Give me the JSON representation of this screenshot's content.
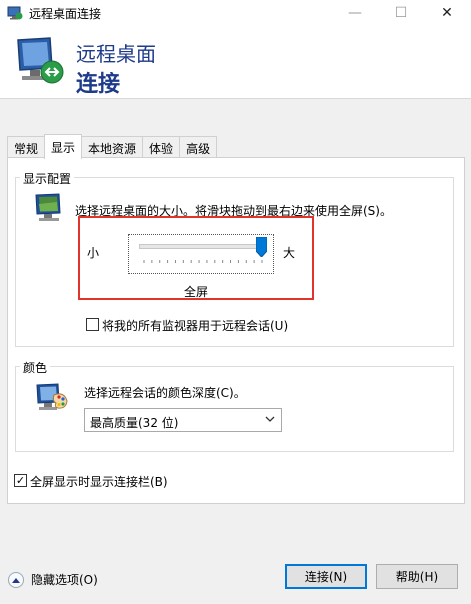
{
  "window": {
    "title": "远程桌面连接",
    "controls": {
      "minimize": "—",
      "maximize": "☐",
      "close": "✕"
    }
  },
  "banner": {
    "line1": "远程桌面",
    "line2": "连接"
  },
  "tabs": [
    {
      "label": "常规",
      "active": false
    },
    {
      "label": "显示",
      "active": true
    },
    {
      "label": "本地资源",
      "active": false
    },
    {
      "label": "体验",
      "active": false
    },
    {
      "label": "高级",
      "active": false
    }
  ],
  "display_config": {
    "legend": "显示配置",
    "description": "选择远程桌面的大小。将滑块拖动到最右边来使用全屏(S)。",
    "slider": {
      "min_label": "小",
      "max_label": "大",
      "value_fraction": 1.0,
      "value_text": "全屏"
    },
    "all_monitors": {
      "label": "将我的所有监视器用于远程会话(U)",
      "checked": false
    }
  },
  "colors": {
    "legend": "颜色",
    "description": "选择远程会话的颜色深度(C)。",
    "selected": "最高质量(32 位)"
  },
  "show_bar": {
    "label": "全屏显示时显示连接栏(B)",
    "checked": true
  },
  "footer": {
    "hide_options": "隐藏选项(O)",
    "connect": "连接(N)",
    "help": "帮助(H)"
  },
  "accent": {
    "highlight": "#e0342c",
    "title": "#1e3a8a",
    "focus": "#0078d7"
  }
}
